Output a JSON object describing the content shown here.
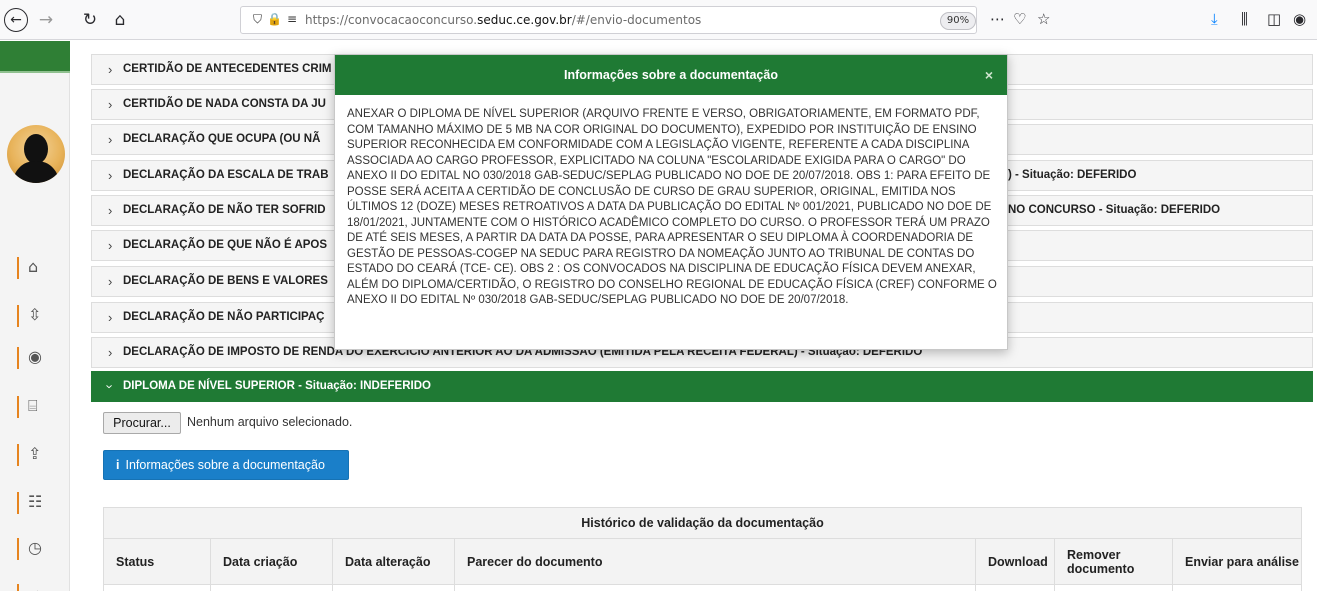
{
  "browser": {
    "url_prefix": "https://convocacaoconcurso.",
    "url_domain": "seduc.ce.gov.br",
    "url_suffix": "/#/envio-documentos",
    "zoom": "90%"
  },
  "accordion": {
    "rows": [
      {
        "label": "CERTIDÃO DE ANTECEDENTES CRIM",
        "suffix": ""
      },
      {
        "label": "CERTIDÃO DE NADA CONSTA DA JU",
        "suffix": ""
      },
      {
        "label": "DECLARAÇÃO QUE OCUPA (OU NÃ",
        "suffix": ""
      },
      {
        "label": "DECLARAÇÃO DA ESCALA DE TRAB",
        "suffix": ") - Situação: DEFERIDO"
      },
      {
        "label": "DECLARAÇÃO DE NÃO TER SOFRID",
        "suffix": "NO CONCURSO - Situação: DEFERIDO"
      },
      {
        "label": "DECLARAÇÃO DE QUE NÃO É APOS",
        "suffix": ""
      },
      {
        "label": "DECLARAÇÃO DE BENS E VALORES",
        "suffix": ""
      },
      {
        "label": "DECLARAÇÃO DE NÃO PARTICIPAÇ",
        "suffix": ""
      },
      {
        "label": "DECLARAÇÃO DE IMPOSTO DE REN",
        "suffix": "DA DO EXERCÍCIO ANTERIOR AO DA ADMISSÃO (EMITIDA PELA RECEITA FEDERAL) - Situação: DEFERIDO"
      }
    ],
    "active_label": "DIPLOMA DE NÍVEL SUPERIOR - Situação: INDEFERIDO"
  },
  "panel": {
    "file_button": "Procurar...",
    "file_status": "Nenhum arquivo selecionado.",
    "info_button": "Informações sobre a documentação"
  },
  "history": {
    "title": "Histórico de validação da documentação",
    "columns": [
      "Status",
      "Data criação",
      "Data alteração",
      "Parecer do documento",
      "Download",
      "Remover documento",
      "Enviar para análise"
    ]
  },
  "modal": {
    "title": "Informações sobre a documentação",
    "close": "×",
    "body": "ANEXAR O DIPLOMA DE NÍVEL SUPERIOR (ARQUIVO FRENTE E VERSO, OBRIGATORIAMENTE, EM FORMATO PDF, COM TAMANHO MÁXIMO DE 5 MB NA COR ORIGINAL DO DOCUMENTO), EXPEDIDO POR INSTITUIÇÃO DE ENSINO SUPERIOR RECONHECIDA EM CONFORMIDADE COM A LEGISLAÇÃO VIGENTE, REFERENTE A CADA DISCIPLINA ASSOCIADA AO CARGO PROFESSOR, EXPLICITADO NA COLUNA \"ESCOLARIDADE EXIGIDA PARA O CARGO\" DO ANEXO II DO EDITAL NO 030/2018 GAB-SEDUC/SEPLAG PUBLICADO NO DOE DE 20/07/2018. OBS 1: PARA EFEITO DE POSSE SERÁ ACEITA A CERTIDÃO DE CONCLUSÃO DE CURSO DE GRAU SUPERIOR, ORIGINAL, EMITIDA NOS ÚLTIMOS 12 (DOZE) MESES RETROATIVOS A DATA DA PUBLICAÇÃO DO EDITAL Nº 001/2021, PUBLICADO NO DOE DE 18/01/2021, JUNTAMENTE COM O HISTÓRICO ACADÊMICO COMPLETO DO CURSO. O PROFESSOR TERÁ UM PRAZO DE ATÉ SEIS MESES, A PARTIR DA DATA DA POSSE, PARA APRESENTAR O SEU DIPLOMA À COORDENADORIA DE GESTÃO DE PESSOAS-COGEP NA SEDUC PARA REGISTRO DA NOMEAÇÃO JUNTO AO TRIBUNAL DE CONTAS DO ESTADO DO CEARÁ (TCE- CE). OBS 2 : OS CONVOCADOS NA DISCIPLINA DE EDUCAÇÃO FÍSICA DEVEM ANEXAR, ALÉM DO DIPLOMA/CERTIDÃO, O REGISTRO DO CONSELHO REGIONAL DE EDUCAÇÃO FÍSICA (CREF) CONFORME O ANEXO II DO EDITAL Nº 030/2018 GAB-SEDUC/SEPLAG PUBLICADO NO DOE DE 20/07/2018."
  }
}
